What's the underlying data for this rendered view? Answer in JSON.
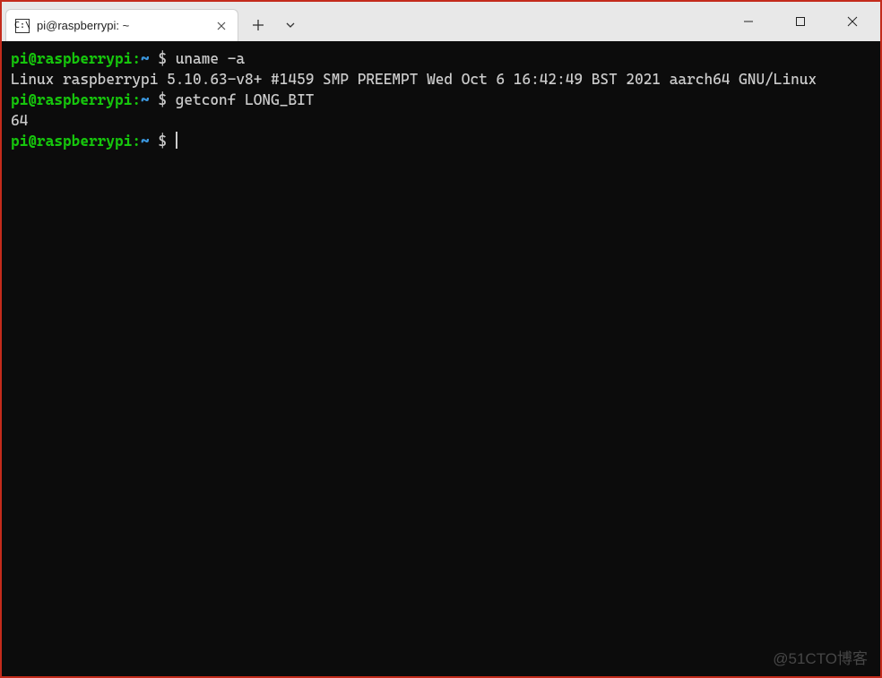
{
  "window": {
    "tab_title": "pi@raspberrypi: ~",
    "tab_icon_text": "C:\\"
  },
  "terminal": {
    "lines": [
      {
        "type": "prompt",
        "user": "pi@raspberrypi",
        "sep": ":",
        "path": "~",
        "dollar": " $ ",
        "command": "uname -a"
      },
      {
        "type": "output",
        "text": "Linux raspberrypi 5.10.63-v8+ #1459 SMP PREEMPT Wed Oct 6 16:42:49 BST 2021 aarch64 GNU/Linux"
      },
      {
        "type": "prompt",
        "user": "pi@raspberrypi",
        "sep": ":",
        "path": "~",
        "dollar": " $ ",
        "command": "getconf LONG_BIT"
      },
      {
        "type": "output",
        "text": "64"
      },
      {
        "type": "prompt",
        "user": "pi@raspberrypi",
        "sep": ":",
        "path": "~",
        "dollar": " $ ",
        "command": "",
        "cursor": true
      }
    ]
  },
  "watermark": "@51CTO博客"
}
